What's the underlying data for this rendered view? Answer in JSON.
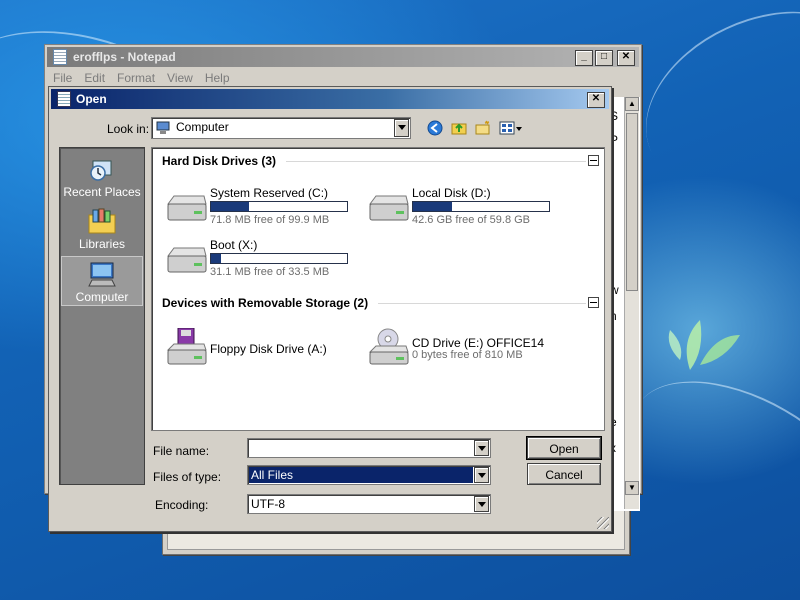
{
  "notepad": {
    "title": "erofflps - Notepad",
    "menu": [
      "File",
      "Edit",
      "Format",
      "View",
      "Help"
    ],
    "caption_buttons": {
      "minimize": "_",
      "maximize": "□",
      "close": "✕"
    },
    "text_fragments": [
      "S",
      "P",
      "r",
      "r",
      "w",
      "n",
      "e",
      "x"
    ]
  },
  "dialog": {
    "title": "Open",
    "close": "✕",
    "look_in_label": "Look in:",
    "look_in_value": "Computer",
    "places": [
      {
        "label": "Recent Places"
      },
      {
        "label": "Libraries"
      },
      {
        "label": "Computer",
        "selected": true
      }
    ],
    "groups": [
      {
        "title": "Hard Disk Drives (3)",
        "drives": [
          {
            "name": "System Reserved (C:)",
            "free": "71.8 MB free of 99.9 MB",
            "used_fraction": 0.28
          },
          {
            "name": "Local Disk (D:)",
            "free": "42.6 GB free of 59.8 GB",
            "used_fraction": 0.29
          },
          {
            "name": "Boot (X:)",
            "free": "31.1 MB free of 33.5 MB",
            "used_fraction": 0.07
          }
        ]
      },
      {
        "title": "Devices with Removable Storage (2)",
        "devices": [
          {
            "name": "Floppy Disk Drive (A:)"
          },
          {
            "name": "CD Drive (E:) OFFICE14",
            "free": "0 bytes free of 810 MB"
          }
        ]
      }
    ],
    "file_name_label": "File name:",
    "file_name_value": "",
    "files_of_type_label": "Files of type:",
    "files_of_type_value": "All Files",
    "encoding_label": "Encoding:",
    "encoding_value": "UTF-8",
    "open_button": "Open",
    "cancel_button": "Cancel"
  }
}
